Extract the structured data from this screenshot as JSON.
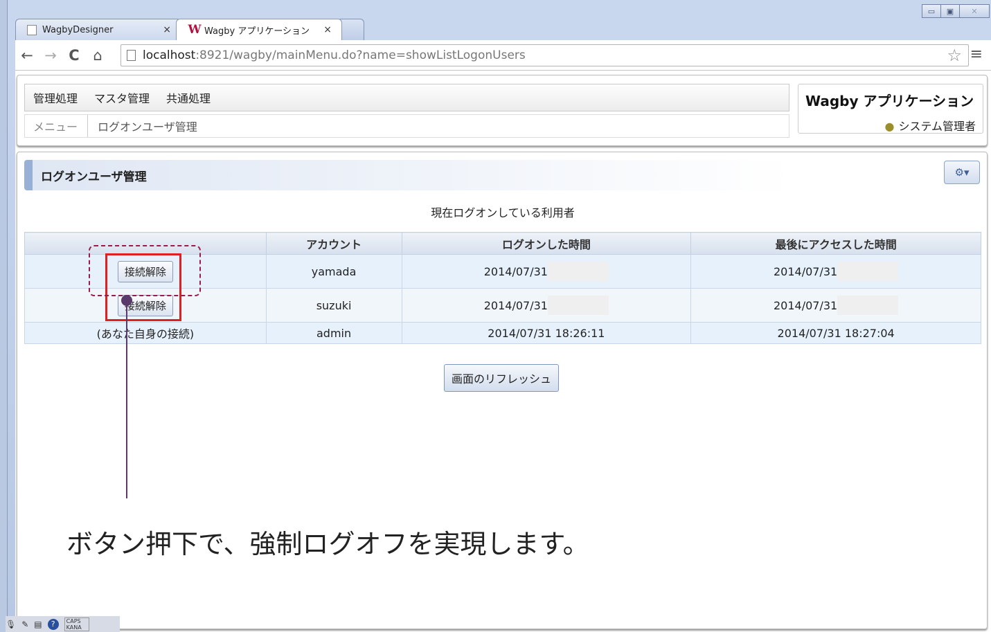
{
  "browser": {
    "tabs": [
      {
        "title": "WagbyDesigner",
        "close": "×"
      },
      {
        "title": "Wagby アプリケーション",
        "close": "×"
      }
    ],
    "url_host": "localhost",
    "url_rest": ":8921/wagby/mainMenu.do?name=showListLogonUsers",
    "window_controls": {
      "minimize": "▭",
      "maximize": "▣",
      "close": "✕"
    },
    "icons": {
      "back": "←",
      "forward": "→",
      "reload": "C",
      "home": "⌂",
      "star": "☆",
      "menu": "≡"
    }
  },
  "menu": {
    "items": [
      "管理処理",
      "マスタ管理",
      "共通処理"
    ]
  },
  "breadcrumb": {
    "root": "メニュー",
    "current": "ログオンユーザ管理"
  },
  "app": {
    "name": "Wagby アプリケーション",
    "user": "システム管理者"
  },
  "page": {
    "title": "ログオンユーザ管理",
    "subtitle": "現在ログオンしている利用者",
    "refresh": "画面のリフレッシュ"
  },
  "table": {
    "headers": [
      "",
      "アカウント",
      "ログオンした時間",
      "最後にアクセスした時間"
    ],
    "rows": [
      {
        "action": "接続解除",
        "account": "yamada",
        "logon": "2014/07/31",
        "last": "2014/07/31"
      },
      {
        "action": "接続解除",
        "account": "suzuki",
        "logon": "2014/07/31",
        "last": "2014/07/31"
      },
      {
        "action": "(あなた自身の接続)",
        "account": "admin",
        "logon": "2014/07/31 18:26:11",
        "last": "2014/07/31 18:27:04"
      }
    ]
  },
  "annotation": {
    "caption": "ボタン押下で、強制ログオフを実現します。",
    "color_box": "#e02020",
    "color_dash": "#9a1a4a"
  },
  "tray": {
    "caps": "CAPS",
    "kana": "KANA"
  }
}
